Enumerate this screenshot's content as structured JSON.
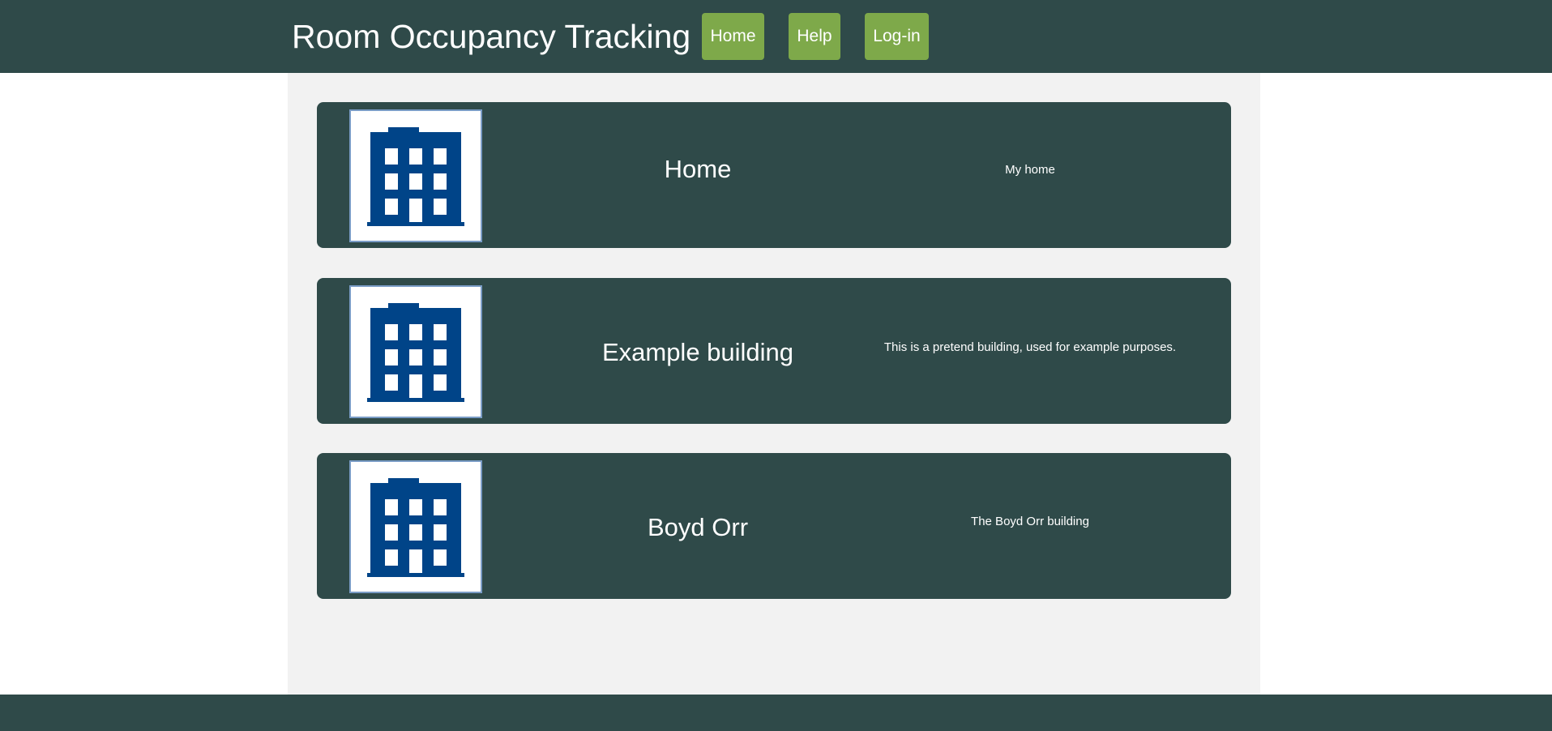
{
  "header": {
    "title": "Room Occupancy Tracking",
    "nav": {
      "home_label": "Home",
      "help_label": "Help",
      "login_label": "Log-in"
    }
  },
  "buildings": [
    {
      "name": "Home",
      "description": "My home",
      "icon": "building-icon"
    },
    {
      "name": "Example building",
      "description": "This is a pretend building, used for example purposes.",
      "icon": "building-icon"
    },
    {
      "name": "Boyd Orr",
      "description": "The Boyd Orr building",
      "icon": "building-icon"
    }
  ],
  "colors": {
    "header_bg": "#2f4a49",
    "nav_button_bg": "#7ea94a",
    "content_bg": "#f2f2f2",
    "card_bg": "#2f4a49",
    "icon_color": "#004488"
  }
}
